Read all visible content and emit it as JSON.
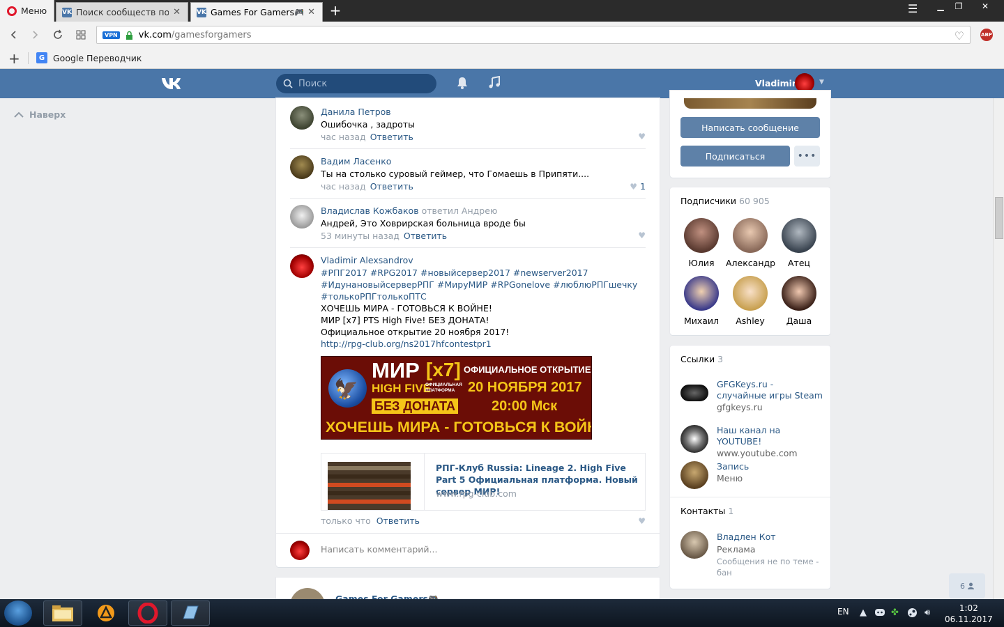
{
  "browser": {
    "menu_label": "Меню",
    "tabs": [
      {
        "title": "Поиск сообществ по зап",
        "active": false
      },
      {
        "title": "Games For Gamers🎮",
        "active": true
      }
    ],
    "url_host": "vk.com",
    "url_path": "/gamesforgamers",
    "vpn_badge": "VPN",
    "adblock_badge": "ABP",
    "bookmarks": [
      {
        "label": "Google Переводчик"
      }
    ]
  },
  "vk": {
    "search_placeholder": "Поиск",
    "user_name": "Vladimir",
    "to_top_label": "Наверх"
  },
  "comments": [
    {
      "author": "Данила Петров",
      "replied": "",
      "text": "Ошибочка , задроты",
      "time": "час назад",
      "reply_label": "Ответить",
      "likes": ""
    },
    {
      "author": "Вадим Ласенко",
      "replied": "",
      "text": "Ты на столько суровый геймер, что Гомаешь в Припяти....",
      "time": "час назад",
      "reply_label": "Ответить",
      "likes": "1"
    },
    {
      "author": "Владислав Кожбаков",
      "replied": "ответил Андрею",
      "text": "Андрей, Это Ховрирская больница вроде бы",
      "time": "53 минуты назад",
      "reply_label": "Ответить",
      "likes": ""
    }
  ],
  "main_comment": {
    "author": "Vladimir Alexsandrov",
    "hashtags_line1": "#РПГ2017 #RPG2017 #новыйсервер2017 #newserver2017",
    "hashtags_line2": "#ИдунановыйсерверРПГ #МируМИР #RPGonelove #люблюРПГшечку",
    "hashtags_line3": "#толькоРПГтолькоПТС",
    "line1": "ХОЧЕШЬ МИРА - ГОТОВЬСЯ К ВОЙНЕ!",
    "line2": "МИР [x7] PTS High Five! БЕЗ ДОНАТА!",
    "line3": "Официальное открытие 20 ноября 2017!",
    "link": "http://rpg-club.org/ns2017hfcontestpr1",
    "time": "только что",
    "reply_label": "Ответить",
    "banner": {
      "mir": "МИР",
      "x7": "[x7]",
      "high_five": "HIGH FIVE",
      "official": "ОФИЦИАЛЬНАЯ ПЛАТФОРМА",
      "opening": "ОФИЦИАЛЬНОЕ ОТКРЫТИЕ",
      "date": "20 НОЯБРЯ 2017",
      "time": "20:00 Мск",
      "no_donate": "БЕЗ ДОНАТА",
      "slogan": "ХОЧЕШЬ МИРА - ГОТОВЬСЯ К ВОЙНЕ"
    },
    "link_card": {
      "title": "РПГ-Клуб Russia: Lineage 2. High Five Part 5 Официальная платформа. Новый сервер МИР!",
      "host": "www.rpg-club.com"
    }
  },
  "write_comment_placeholder": "Написать комментарий...",
  "next_post_author": "Games For Gamers🎮",
  "sidebar": {
    "message_button": "Написать сообщение",
    "subscribe_button": "Подписаться",
    "more_button": "•••",
    "subscribers_title": "Подписчики",
    "subscribers_count": "60 905",
    "subscribers": [
      {
        "name": "Юлия"
      },
      {
        "name": "Александр"
      },
      {
        "name": "Атец"
      },
      {
        "name": "Михаил"
      },
      {
        "name": "Ashley"
      },
      {
        "name": "Даша"
      }
    ],
    "links_title": "Ссылки",
    "links_count": "3",
    "links": [
      {
        "title": "GFGKeys.ru - случайные игры Steam",
        "sub": "gfgkeys.ru"
      },
      {
        "title": "Наш канал на YOUTUBE!",
        "sub": "www.youtube.com"
      },
      {
        "title": "Запись",
        "sub": "Меню"
      }
    ],
    "contacts_title": "Контакты",
    "contacts_count": "1",
    "contacts": [
      {
        "name": "Владлен Кот",
        "role": "Реклама",
        "note": "Сообщения не по теме - бан"
      }
    ],
    "online_count": "6"
  },
  "taskbar": {
    "lang": "EN",
    "time": "1:02",
    "date": "06.11.2017"
  }
}
